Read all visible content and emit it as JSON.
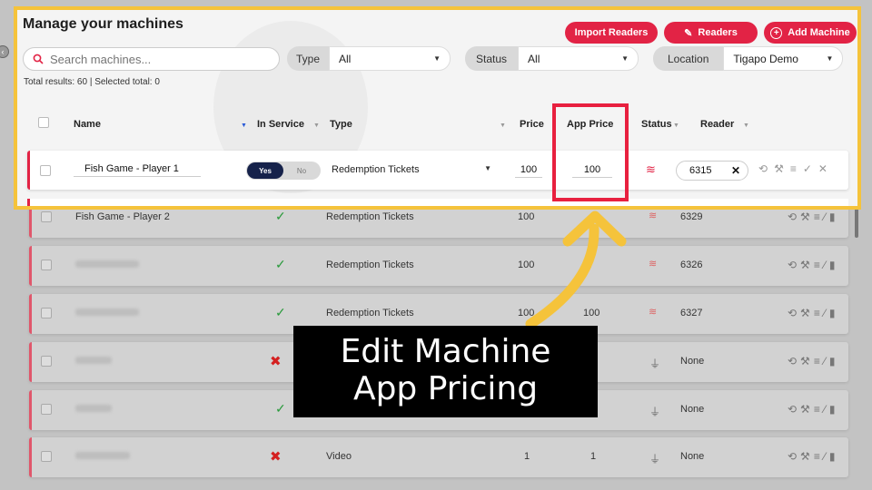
{
  "header": {
    "title": "Manage your machines",
    "import_readers": "Import Readers",
    "readers": "Readers",
    "add_machine": "Add Machine"
  },
  "search": {
    "placeholder": "Search machines..."
  },
  "filters": {
    "type": {
      "label": "Type",
      "value": "All"
    },
    "status": {
      "label": "Status",
      "value": "All"
    },
    "location": {
      "label": "Location",
      "value": "Tigapo Demo"
    }
  },
  "totals": "Total results: 60 | Selected total: 0",
  "columns": {
    "name": "Name",
    "in_service": "In Service",
    "type": "Type",
    "price": "Price",
    "app_price": "App Price",
    "status": "Status",
    "reader": "Reader"
  },
  "editing_row": {
    "name": "Fish Game - Player 1",
    "in_service_yes": "Yes",
    "in_service_no": "No",
    "type": "Redemption Tickets",
    "price": "100",
    "app_price": "100",
    "reader": "6315"
  },
  "rows": [
    {
      "name": "Fish Game - Player 2",
      "type": "Redemption Tickets",
      "price": "100",
      "app_price": "",
      "reader": "6329"
    },
    {
      "name": "",
      "type": "Redemption Tickets",
      "price": "100",
      "app_price": "1",
      "reader": "6326"
    },
    {
      "name": "",
      "type": "Redemption Tickets",
      "price": "100",
      "app_price": "100",
      "reader": "6327"
    },
    {
      "name": "",
      "type": "",
      "price": "",
      "app_price": "",
      "reader": "None"
    },
    {
      "name": "",
      "type": "",
      "price": "",
      "app_price": "",
      "reader": "None"
    },
    {
      "name": "",
      "type": "Video",
      "price": "1",
      "app_price": "1",
      "reader": "None"
    }
  ],
  "caption": {
    "line1": "Edit Machine",
    "line2": "App Pricing"
  },
  "colors": {
    "accent_red": "#e22345",
    "highlight_yellow": "#f5c33b",
    "highlight_box": "#e8203f"
  }
}
